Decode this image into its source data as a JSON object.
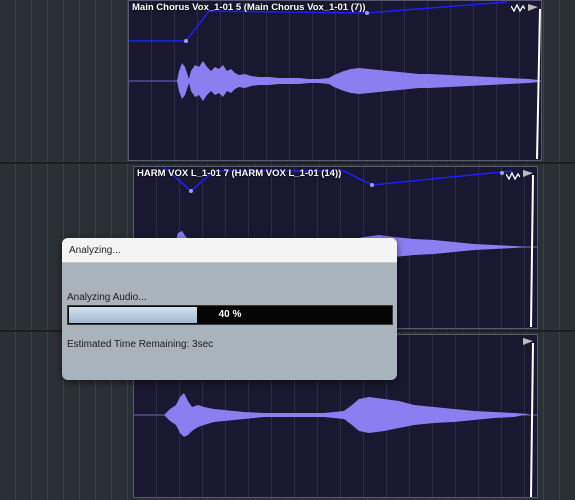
{
  "clips": [
    {
      "title": "Main Chorus Vox_1-01 5 (Main Chorus Vox_1-01 (7))"
    },
    {
      "title": "HARM VOX L_1-01 7 (HARM VOX L_1-01 (14))"
    },
    {
      "title": ""
    }
  ],
  "dialog": {
    "title": "Analyzing...",
    "status_label": "Analyzing Audio...",
    "progress_text": "40 %",
    "progress_fraction": 0.4,
    "time_remaining": "Estimated Time Remaining: 3sec"
  },
  "colors": {
    "clip_bg": "#1a1830",
    "waveform": "#8b7ef0",
    "automation": "#1a20ff",
    "dialog_bg": "#a9b3bb",
    "progress_fill": "#b9cfe2"
  }
}
